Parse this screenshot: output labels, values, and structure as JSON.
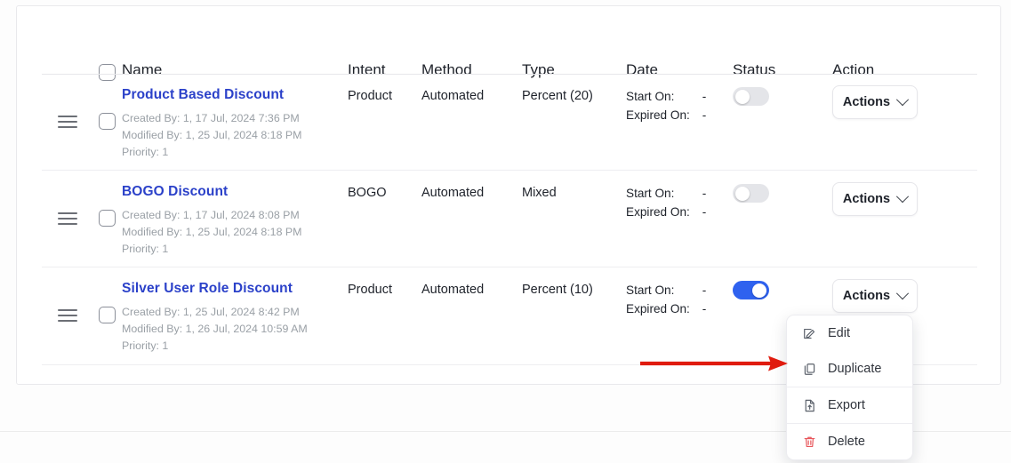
{
  "table": {
    "columns": [
      {
        "key": "name",
        "label": "Name"
      },
      {
        "key": "intent",
        "label": "Intent"
      },
      {
        "key": "method",
        "label": "Method"
      },
      {
        "key": "type",
        "label": "Type"
      },
      {
        "key": "date",
        "label": "Date"
      },
      {
        "key": "status",
        "label": "Status"
      },
      {
        "key": "action",
        "label": "Action"
      }
    ],
    "date_labels": {
      "start": "Start On:",
      "expired": "Expired On:"
    },
    "rows": [
      {
        "name": "Product Based Discount",
        "created": "Created By: 1, 17 Jul, 2024 7:36 PM",
        "modified": "Modified By: 1, 25 Jul, 2024 8:18 PM",
        "priority": "Priority: 1",
        "intent": "Product",
        "method": "Automated",
        "type": "Percent (20)",
        "start_on": "-",
        "expired_on": "-",
        "status_on": false,
        "action_label": "Actions"
      },
      {
        "name": "BOGO Discount",
        "created": "Created By: 1, 17 Jul, 2024 8:08 PM",
        "modified": "Modified By: 1, 25 Jul, 2024 8:18 PM",
        "priority": "Priority: 1",
        "intent": "BOGO",
        "method": "Automated",
        "type": "Mixed",
        "start_on": "-",
        "expired_on": "-",
        "status_on": false,
        "action_label": "Actions"
      },
      {
        "name": "Silver User Role Discount",
        "created": "Created By: 1, 25 Jul, 2024 8:42 PM",
        "modified": "Modified By: 1, 26 Jul, 2024 10:59 AM",
        "priority": "Priority: 1",
        "intent": "Product",
        "method": "Automated",
        "type": "Percent (10)",
        "start_on": "-",
        "expired_on": "-",
        "status_on": true,
        "action_label": "Actions"
      }
    ]
  },
  "action_menu": {
    "items": [
      {
        "label": "Edit",
        "icon": "edit-icon"
      },
      {
        "label": "Duplicate",
        "icon": "duplicate-icon"
      },
      {
        "label": "Export",
        "icon": "export-icon"
      },
      {
        "label": "Delete",
        "icon": "delete-icon"
      }
    ]
  },
  "annotation": {
    "type": "arrow",
    "direction": "right",
    "target": "Duplicate",
    "color": "#e01b0e"
  },
  "colors": {
    "link": "#2b41c9",
    "toggle_on": "#2f62ef",
    "toggle_off": "#e4e5e9",
    "meta_text": "#9aa0a6",
    "delete_icon": "#e8575c",
    "border": "#e9e9ec"
  }
}
